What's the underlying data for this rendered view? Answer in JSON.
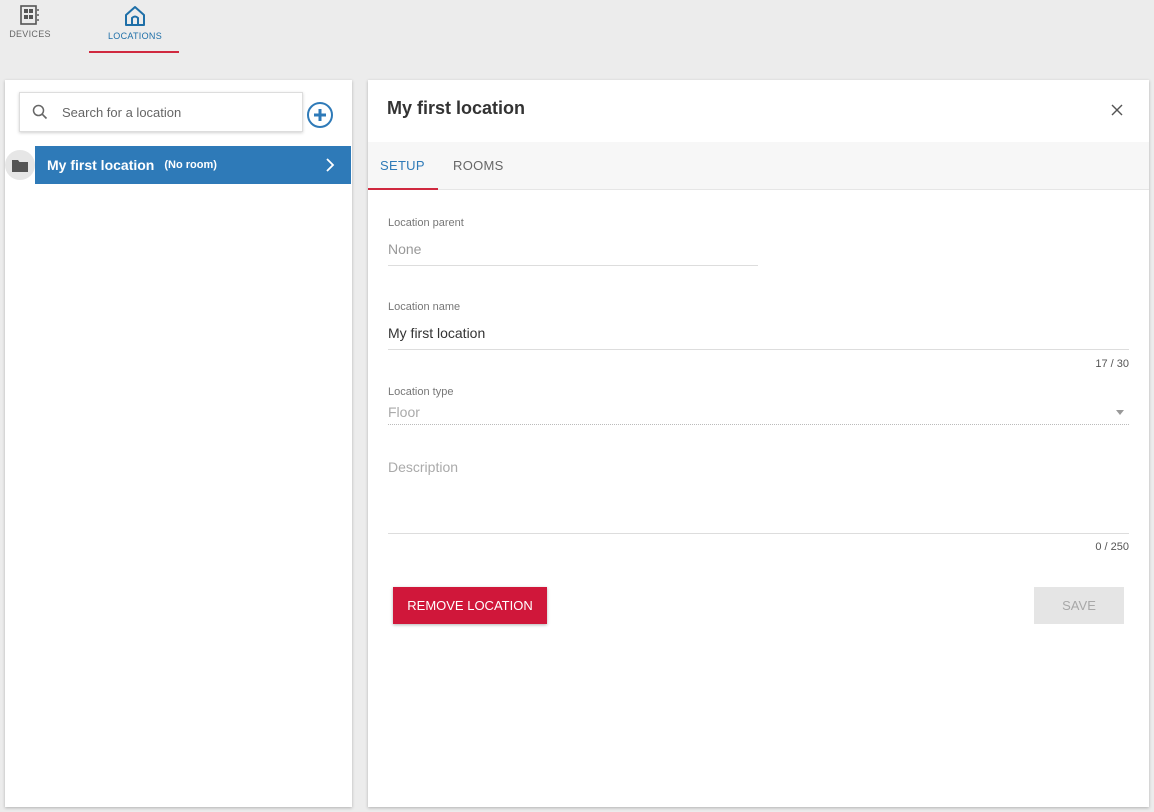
{
  "nav": {
    "devices_label": "DEVICES",
    "locations_label": "LOCATIONS",
    "active_color": "#1e6fa8",
    "indicator_color": "#d0293f"
  },
  "sidebar": {
    "search_placeholder": "Search for a location",
    "locations": [
      {
        "name": "My first location",
        "sub": "(No room)",
        "selected": true
      }
    ],
    "selected_color": "#2e7ab8"
  },
  "detail": {
    "title": "My first location",
    "tabs": [
      {
        "label": "SETUP",
        "active": true
      },
      {
        "label": "ROOMS",
        "active": false
      }
    ],
    "fields": {
      "parent": {
        "label": "Location parent",
        "value": "None"
      },
      "name": {
        "label": "Location name",
        "value": "My first location",
        "counter": "17 / 30"
      },
      "type": {
        "label": "Location type",
        "value": "Floor"
      },
      "description": {
        "placeholder": "Description",
        "counter": "0 / 250"
      }
    },
    "buttons": {
      "remove": "REMOVE LOCATION",
      "save": "SAVE"
    },
    "remove_color": "#d0173a"
  }
}
